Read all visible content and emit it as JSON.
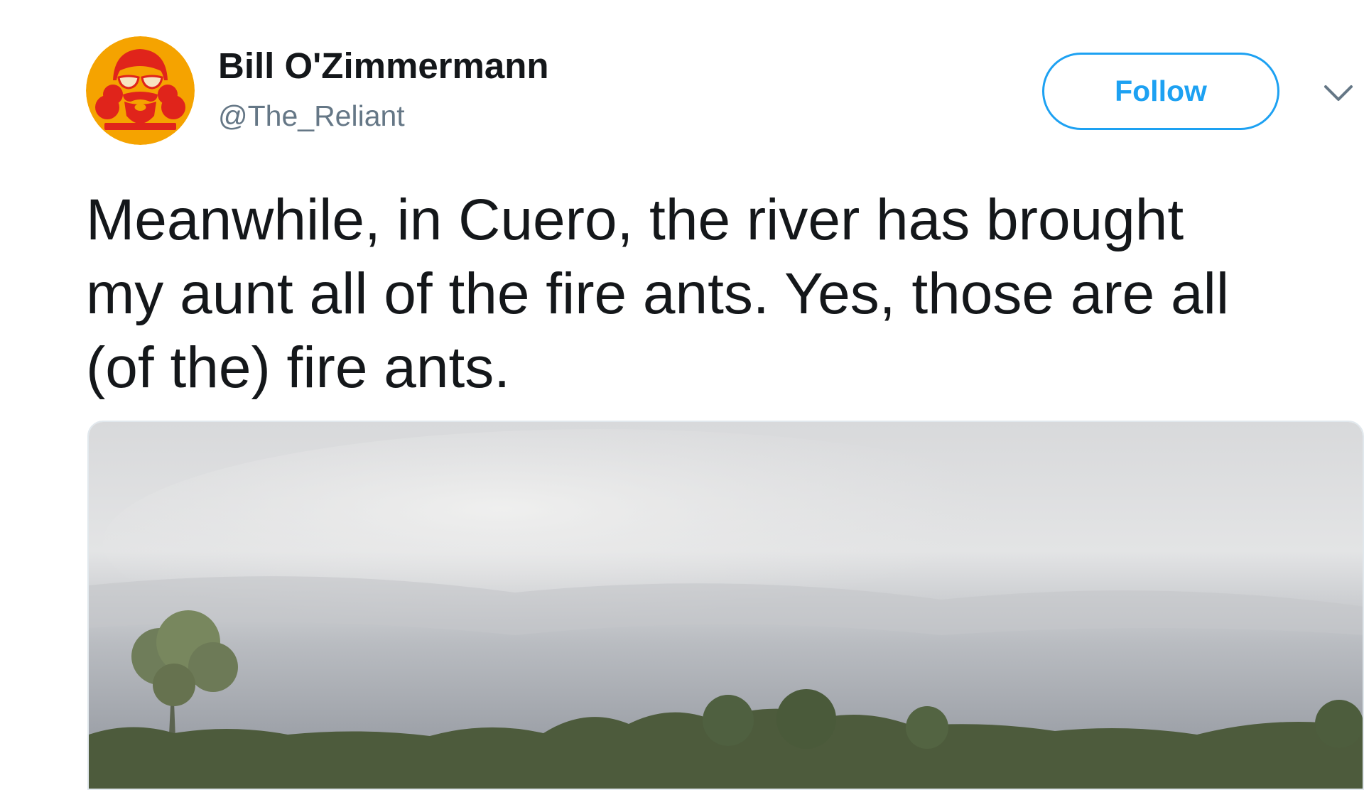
{
  "tweet": {
    "author": {
      "name": "Bill O'Zimmermann",
      "handle": "@The_Reliant",
      "avatar_icon": "bearded-man-sunglasses-logo-icon",
      "avatar_color": "#f5a300",
      "avatar_figure_color": "#e0241b"
    },
    "follow_label": "Follow",
    "menu_icon": "chevron-down-icon",
    "text_lines": [
      "Meanwhile, in Cuero, the river has brought",
      "my aunt all of the fire ants. Yes, those are all",
      "(of the) fire ants."
    ],
    "media": {
      "kind": "photo",
      "description_icon": "landscape-photo-icon"
    }
  },
  "colors": {
    "accent": "#1da1f2",
    "text": "#14171a",
    "secondary_text": "#657786"
  }
}
